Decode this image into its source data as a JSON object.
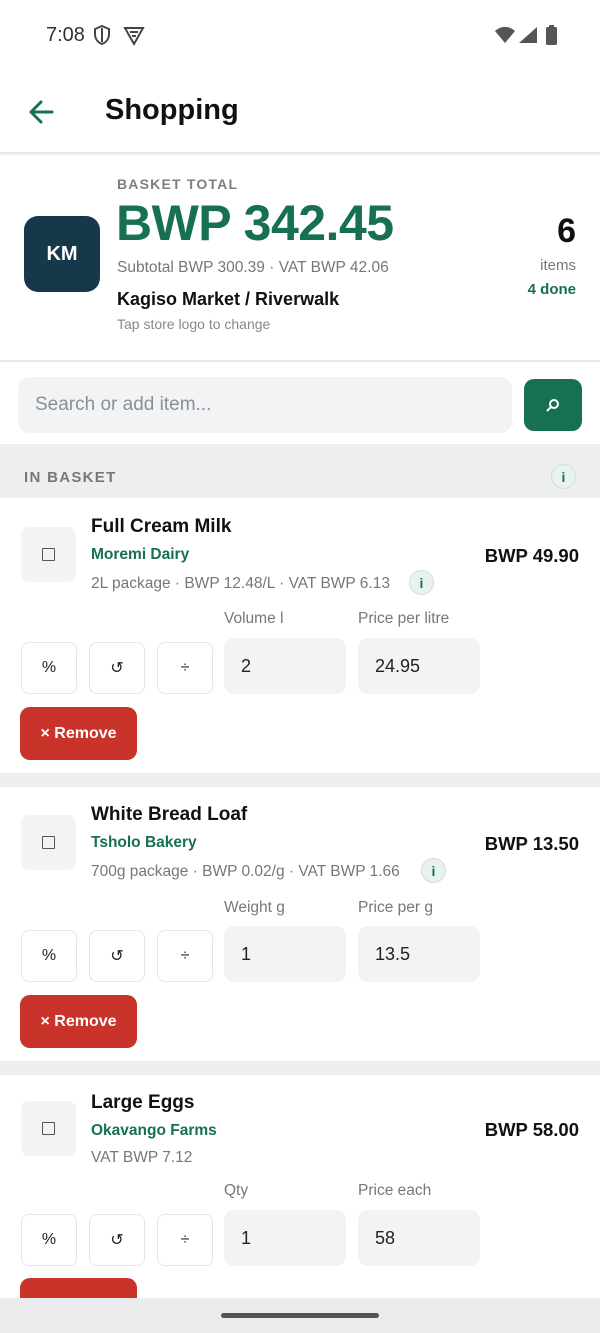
{
  "status_bar": {
    "time": "7:08"
  },
  "app_bar": {
    "title": "Shopping"
  },
  "summary": {
    "store_initials": "KM",
    "basket_label": "BASKET TOTAL",
    "basket_total": "BWP 342.45",
    "subtotal_line": "Subtotal BWP 300.39 · VAT BWP 42.06",
    "store_name": "Kagiso Market / Riverwalk",
    "store_hint": "Tap store logo to change",
    "item_count": "6",
    "item_count_label": "items",
    "done_label": "4 done"
  },
  "search": {
    "placeholder": "Search or add item...",
    "value": ""
  },
  "section": {
    "title": "IN BASKET",
    "info": "i"
  },
  "tools": {
    "percent": "%",
    "reset": "↺",
    "divide": "÷",
    "info": "i",
    "remove": "× Remove"
  },
  "items": [
    {
      "name": "Full Cream Milk",
      "brand": "Moremi Dairy",
      "detail": "2L package · BWP 12.48/L · VAT BWP 6.13",
      "price": "BWP 49.90",
      "qty_label": "Volume l",
      "qty_value": "2",
      "unit_label": "Price per litre",
      "unit_value": "24.95"
    },
    {
      "name": "White Bread Loaf",
      "brand": "Tsholo Bakery",
      "detail": "700g package · BWP 0.02/g · VAT BWP 1.66",
      "price": "BWP 13.50",
      "qty_label": "Weight g",
      "qty_value": "1",
      "unit_label": "Price per g",
      "unit_value": "13.5"
    },
    {
      "name": "Large Eggs",
      "brand": "Okavango Farms",
      "detail": "VAT BWP 7.12",
      "price": "BWP 58.00",
      "qty_label": "Qty",
      "qty_value": "1",
      "unit_label": "Price each",
      "unit_value": "58"
    }
  ],
  "colors": {
    "accent": "#17704f",
    "logo_bg": "#16384a",
    "danger": "#c8342a"
  },
  "icons": {
    "back": "arrow-left-icon",
    "search": "search-icon"
  }
}
